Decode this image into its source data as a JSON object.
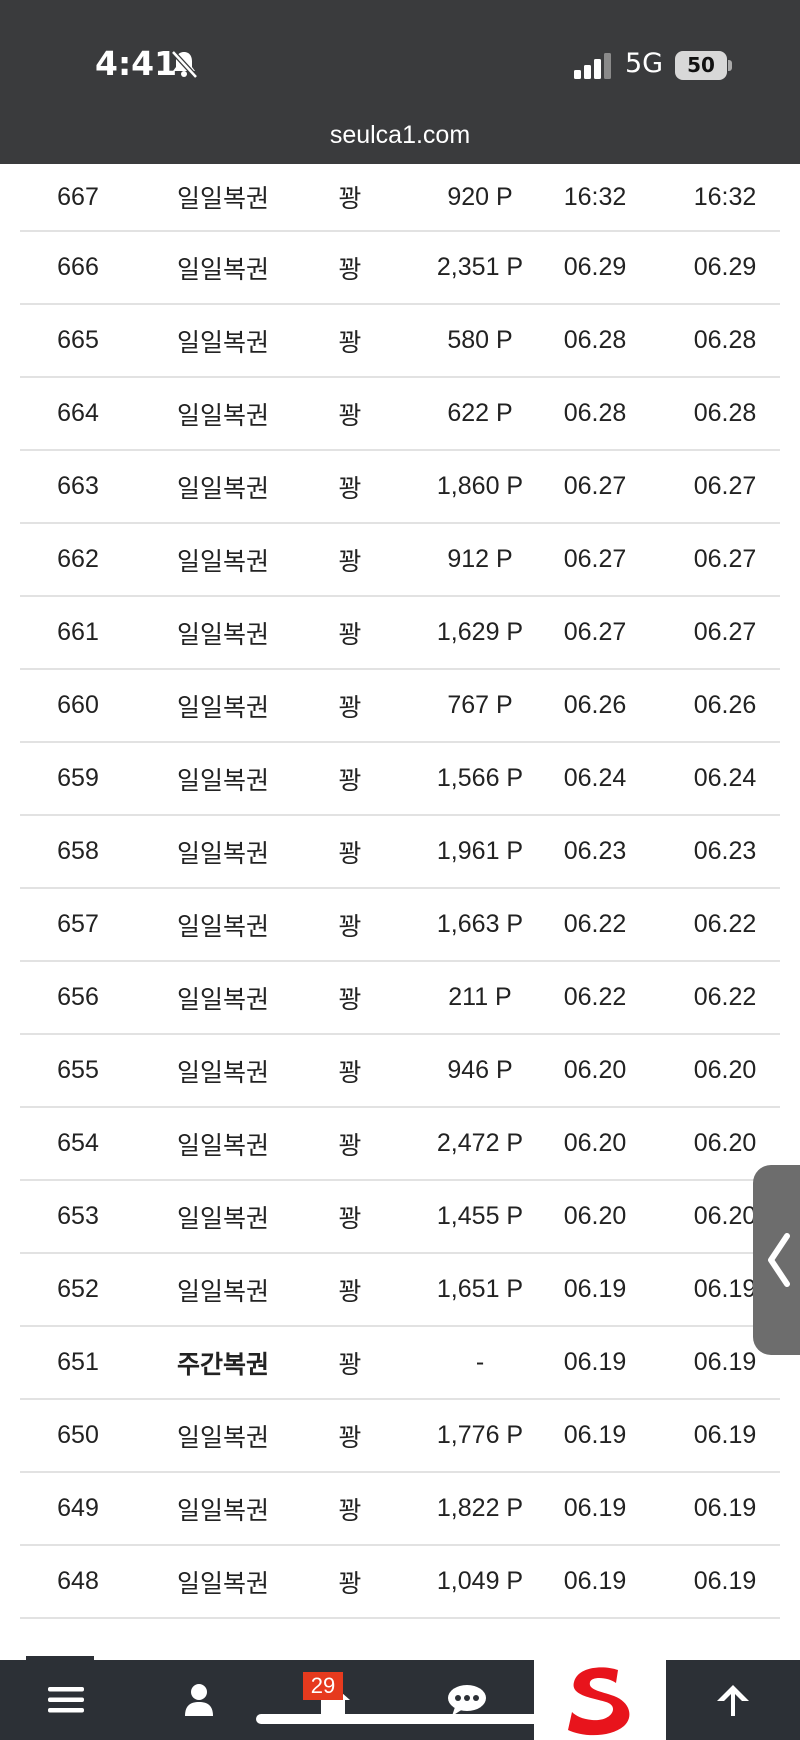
{
  "status": {
    "time": "4:41",
    "network": "5G",
    "battery": "50"
  },
  "browser": {
    "url": "seulca1.com"
  },
  "rows": [
    {
      "no": "667",
      "category": "일일복권",
      "result": "꽝",
      "points": "920 P",
      "date1": "16:32",
      "date2": "16:32"
    },
    {
      "no": "666",
      "category": "일일복권",
      "result": "꽝",
      "points": "2,351 P",
      "date1": "06.29",
      "date2": "06.29"
    },
    {
      "no": "665",
      "category": "일일복권",
      "result": "꽝",
      "points": "580 P",
      "date1": "06.28",
      "date2": "06.28"
    },
    {
      "no": "664",
      "category": "일일복권",
      "result": "꽝",
      "points": "622 P",
      "date1": "06.28",
      "date2": "06.28"
    },
    {
      "no": "663",
      "category": "일일복권",
      "result": "꽝",
      "points": "1,860 P",
      "date1": "06.27",
      "date2": "06.27"
    },
    {
      "no": "662",
      "category": "일일복권",
      "result": "꽝",
      "points": "912 P",
      "date1": "06.27",
      "date2": "06.27"
    },
    {
      "no": "661",
      "category": "일일복권",
      "result": "꽝",
      "points": "1,629 P",
      "date1": "06.27",
      "date2": "06.27"
    },
    {
      "no": "660",
      "category": "일일복권",
      "result": "꽝",
      "points": "767 P",
      "date1": "06.26",
      "date2": "06.26"
    },
    {
      "no": "659",
      "category": "일일복권",
      "result": "꽝",
      "points": "1,566 P",
      "date1": "06.24",
      "date2": "06.24"
    },
    {
      "no": "658",
      "category": "일일복권",
      "result": "꽝",
      "points": "1,961 P",
      "date1": "06.23",
      "date2": "06.23"
    },
    {
      "no": "657",
      "category": "일일복권",
      "result": "꽝",
      "points": "1,663 P",
      "date1": "06.22",
      "date2": "06.22"
    },
    {
      "no": "656",
      "category": "일일복권",
      "result": "꽝",
      "points": "211 P",
      "date1": "06.22",
      "date2": "06.22"
    },
    {
      "no": "655",
      "category": "일일복권",
      "result": "꽝",
      "points": "946 P",
      "date1": "06.20",
      "date2": "06.20"
    },
    {
      "no": "654",
      "category": "일일복권",
      "result": "꽝",
      "points": "2,472 P",
      "date1": "06.20",
      "date2": "06.20"
    },
    {
      "no": "653",
      "category": "일일복권",
      "result": "꽝",
      "points": "1,455 P",
      "date1": "06.20",
      "date2": "06.20"
    },
    {
      "no": "652",
      "category": "일일복권",
      "result": "꽝",
      "points": "1,651 P",
      "date1": "06.19",
      "date2": "06.19"
    },
    {
      "no": "651",
      "category": "주간복권",
      "result": "꽝",
      "points": "-",
      "date1": "06.19",
      "date2": "06.19",
      "bold": true
    },
    {
      "no": "650",
      "category": "일일복권",
      "result": "꽝",
      "points": "1,776 P",
      "date1": "06.19",
      "date2": "06.19"
    },
    {
      "no": "649",
      "category": "일일복권",
      "result": "꽝",
      "points": "1,822 P",
      "date1": "06.19",
      "date2": "06.19"
    },
    {
      "no": "648",
      "category": "일일복권",
      "result": "꽝",
      "points": "1,049 P",
      "date1": "06.19",
      "date2": "06.19"
    }
  ],
  "tabbar": {
    "notification_count": "29"
  },
  "icons": {
    "bell": "bell-slash-icon",
    "signal": "cellular-signal-icon",
    "menu": "hamburger-menu-icon",
    "user": "user-icon",
    "home": "home-icon",
    "chat": "chat-bubble-icon",
    "logo": "brand-s-logo-icon",
    "top": "arrow-up-icon",
    "side": "chevron-left-icon"
  },
  "colors": {
    "bar": "#3a3b3d",
    "tabbar": "#2c3036",
    "badge": "#e63a1e",
    "logo": "#e8141c",
    "side_tab": "#6d6d6d"
  }
}
